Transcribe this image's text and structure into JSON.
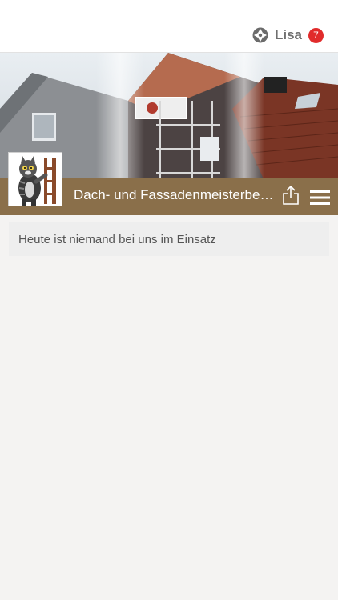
{
  "topbar": {
    "user_name": "Lisa",
    "badge_count": "7",
    "brand_icon": "crosshair-logo-icon"
  },
  "hero": {
    "title": "Dach- und Fassadenmeisterbetrieb",
    "bar_color": "#8a6f4a",
    "share_icon": "share-icon",
    "menu_icon": "hamburger-menu-icon",
    "logo": "cat-chimney-sweep-logo"
  },
  "notice": {
    "text": "Heute ist niemand bei uns im Einsatz"
  },
  "colors": {
    "background": "#f4f3f2",
    "badge": "#e12b2b",
    "text": "#555555"
  }
}
